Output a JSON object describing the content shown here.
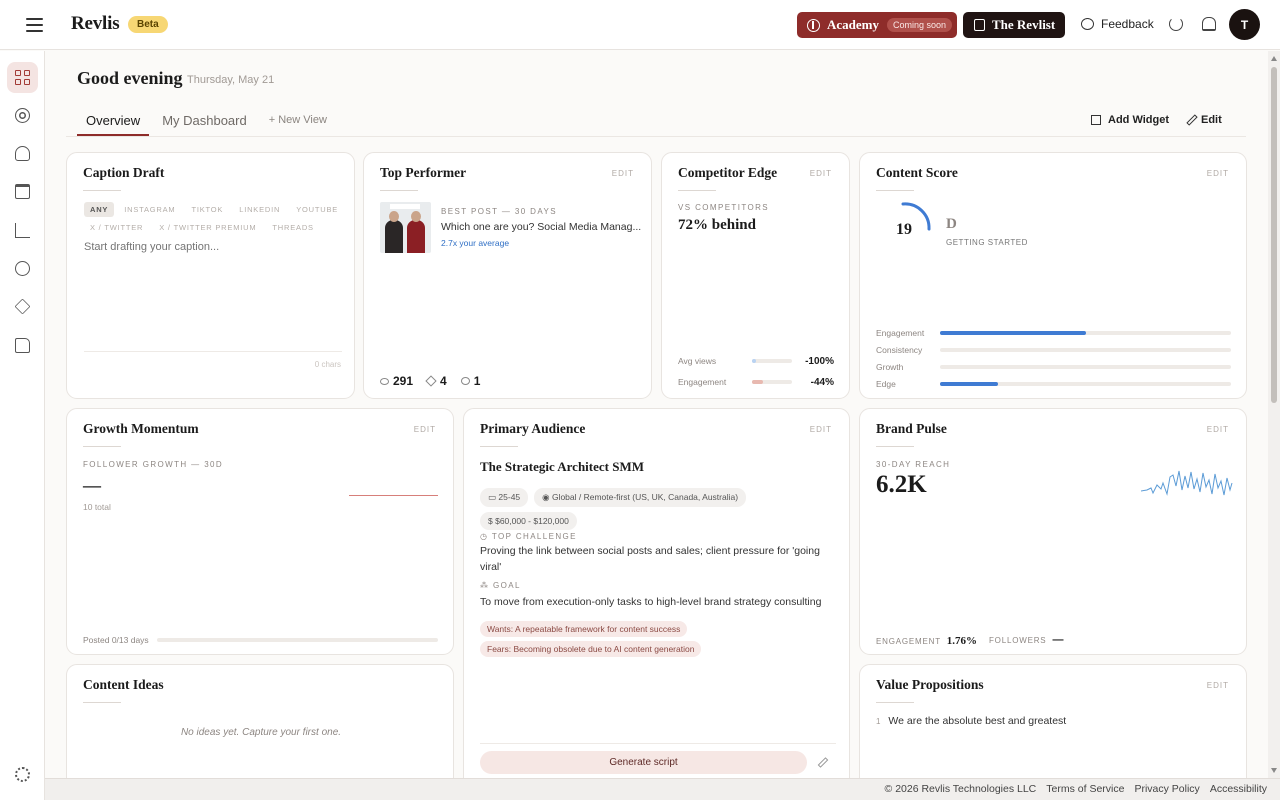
{
  "app": {
    "logo": "Revlis",
    "beta": "Beta",
    "academy": "Academy",
    "academy_badge": "Coming soon",
    "revlist": "The Revlist",
    "feedback": "Feedback",
    "avatar_initial": "T",
    "accent_color": "#8e2c2a"
  },
  "sidebar": {
    "items": [
      {
        "name": "dashboard-icon",
        "active": true
      },
      {
        "name": "target-icon"
      },
      {
        "name": "users-icon"
      },
      {
        "name": "calendar-icon"
      },
      {
        "name": "bar-chart-icon"
      },
      {
        "name": "globe-icon"
      },
      {
        "name": "layers-icon"
      },
      {
        "name": "folder-icon"
      }
    ],
    "footer_icon": "gear-icon"
  },
  "header": {
    "greeting": "Good evening",
    "date": "Thursday, May 21",
    "tabs": [
      "Overview",
      "My Dashboard",
      "+ New View"
    ],
    "add_widget": "Add Widget",
    "edit": "Edit"
  },
  "caption_draft": {
    "title": "Caption Draft",
    "platforms_row1": [
      "ANY",
      "INSTAGRAM",
      "TIKTOK",
      "LINKEDIN",
      "YOUTUBE"
    ],
    "platforms_row2": [
      "X / TWITTER",
      "X / TWITTER PREMIUM",
      "THREADS"
    ],
    "placeholder": "Start drafting your caption...",
    "chars": "0 chars"
  },
  "top_performer": {
    "title": "Top Performer",
    "edit": "EDIT",
    "label": "BEST POST — 30 DAYS",
    "post": "Which one are you? Social Media Manag...",
    "multiplier": "2.7x your average",
    "views": "291",
    "likes": "4",
    "comments": "1"
  },
  "competitor_edge": {
    "title": "Competitor Edge",
    "edit": "EDIT",
    "label": "VS COMPETITORS",
    "value": "72% behind",
    "rows": [
      {
        "label": "Avg views",
        "value": "-100%",
        "fill": 0.1,
        "color": "#b9d3f2"
      },
      {
        "label": "Engagement",
        "value": "-44%",
        "fill": 0.28,
        "color": "#e8b9b0"
      }
    ]
  },
  "content_score": {
    "title": "Content Score",
    "edit": "EDIT",
    "score": "19",
    "grade": "D",
    "status": "GETTING STARTED",
    "rows": [
      {
        "label": "Engagement",
        "fill": 0.5
      },
      {
        "label": "Consistency",
        "fill": 0
      },
      {
        "label": "Growth",
        "fill": 0
      },
      {
        "label": "Edge",
        "fill": 0.2
      }
    ]
  },
  "growth_momentum": {
    "title": "Growth Momentum",
    "edit": "EDIT",
    "label": "FOLLOWER GROWTH — 30D",
    "value": "—",
    "total": "10 total",
    "posted": "Posted 0/13 days"
  },
  "primary_audience": {
    "title": "Primary Audience",
    "edit": "EDIT",
    "persona": "The Strategic Architect SMM",
    "age": "25-45",
    "location": "Global / Remote-first (US, UK, Canada, Australia)",
    "income": "$60,000 - $120,000",
    "challenge_label": "TOP CHALLENGE",
    "challenge": "Proving the link between social posts and sales; client pressure for 'going viral'",
    "goal_label": "GOAL",
    "goal": "To move from execution-only tasks to high-level brand strategy consulting",
    "wants": "Wants: A repeatable framework for content success",
    "fears": "Fears: Becoming obsolete due to AI content generation",
    "generate": "Generate script"
  },
  "brand_pulse": {
    "title": "Brand Pulse",
    "edit": "EDIT",
    "label": "30-DAY REACH",
    "value": "6.2K",
    "engagement_label": "ENGAGEMENT",
    "engagement_value": "1.76%",
    "followers_label": "FOLLOWERS",
    "followers_value": "—"
  },
  "content_ideas": {
    "title": "Content Ideas",
    "empty": "No ideas yet. Capture your first one."
  },
  "value_props": {
    "title": "Value Propositions",
    "edit": "EDIT",
    "items": [
      {
        "num": "1",
        "text": "We are the absolute best and greatest"
      }
    ]
  },
  "footer": {
    "copyright": "© 2026 Revlis Technologies LLC",
    "terms": "Terms of Service",
    "privacy": "Privacy Policy",
    "accessibility": "Accessibility"
  }
}
